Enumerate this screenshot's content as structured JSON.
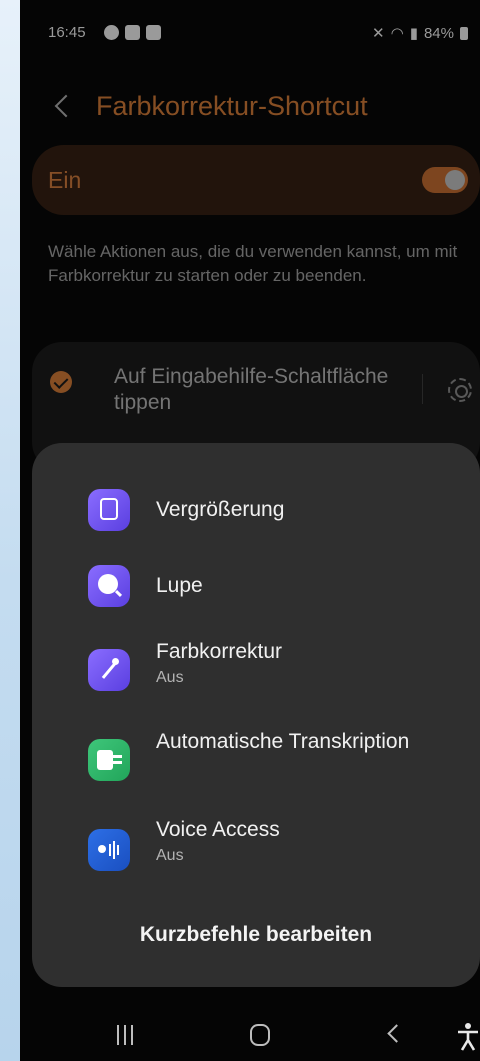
{
  "status_bar": {
    "time": "16:45",
    "battery": "84%",
    "icons": [
      "facebook-icon",
      "gallery-icon",
      "mail-icon",
      "mute-icon",
      "wifi-icon",
      "signal-icon",
      "battery-icon"
    ]
  },
  "header": {
    "title": "Farbkorrektur-Shortcut"
  },
  "toggle": {
    "label": "Ein",
    "state": "on"
  },
  "description": "Wähle Aktionen aus, die du verwenden kannst, um mit Farbkorrektur zu starten oder zu beenden.",
  "option": {
    "label": "Auf Eingabehilfe-Schaltfläche tippen",
    "checked": true
  },
  "popup": {
    "items": [
      {
        "title": "Vergrößerung",
        "subtitle": "",
        "icon": "magnification-icon",
        "color": "#6f55f0"
      },
      {
        "title": "Lupe",
        "subtitle": "",
        "icon": "magnifier-icon",
        "color": "#6f55f0"
      },
      {
        "title": "Farbkorrektur",
        "subtitle": "Aus",
        "icon": "color-correction-icon",
        "color": "#6f55f0"
      },
      {
        "title": "Automatische Transkription",
        "subtitle": "",
        "icon": "live-transcribe-icon",
        "color": "#2fb86a"
      },
      {
        "title": "Voice Access",
        "subtitle": "Aus",
        "icon": "voice-access-icon",
        "color": "#2d6fe6"
      }
    ],
    "edit_label": "Kurzbefehle bearbeiten"
  },
  "colors": {
    "accent": "#f08a3c",
    "popup_bg": "#2f2f2f",
    "background": "#050505"
  }
}
